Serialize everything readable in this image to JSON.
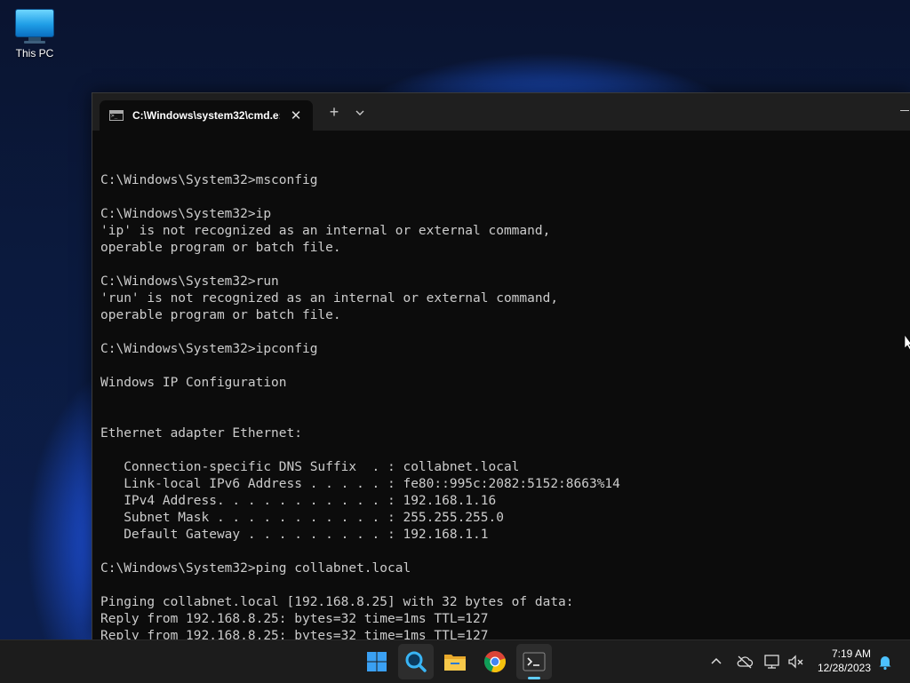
{
  "desktop": {
    "icons": [
      {
        "label": "This PC",
        "icon": "this-pc-icon"
      }
    ]
  },
  "terminal": {
    "tab_title": "C:\\Windows\\system32\\cmd.e:",
    "new_tab_symbol": "+",
    "close_symbol": "✕",
    "console_lines": [
      "",
      "C:\\Windows\\System32>msconfig",
      "",
      "C:\\Windows\\System32>ip",
      "'ip' is not recognized as an internal or external command,",
      "operable program or batch file.",
      "",
      "C:\\Windows\\System32>run",
      "'run' is not recognized as an internal or external command,",
      "operable program or batch file.",
      "",
      "C:\\Windows\\System32>ipconfig",
      "",
      "Windows IP Configuration",
      "",
      "",
      "Ethernet adapter Ethernet:",
      "",
      "   Connection-specific DNS Suffix  . : collabnet.local",
      "   Link-local IPv6 Address . . . . . : fe80::995c:2082:5152:8663%14",
      "   IPv4 Address. . . . . . . . . . . : 192.168.1.16",
      "   Subnet Mask . . . . . . . . . . . : 255.255.255.0",
      "   Default Gateway . . . . . . . . . : 192.168.1.1",
      "",
      "C:\\Windows\\System32>ping collabnet.local",
      "",
      "Pinging collabnet.local [192.168.8.25] with 32 bytes of data:",
      "Reply from 192.168.8.25: bytes=32 time=1ms TTL=127",
      "Reply from 192.168.8.25: bytes=32 time=1ms TTL=127"
    ]
  },
  "taskbar": {
    "apps": [
      {
        "name": "start",
        "icon": "windows-logo-icon",
        "active": false
      },
      {
        "name": "search",
        "icon": "search-icon",
        "active": false
      },
      {
        "name": "file-explorer",
        "icon": "folder-icon",
        "active": false
      },
      {
        "name": "chrome",
        "icon": "chrome-icon",
        "active": false
      },
      {
        "name": "terminal",
        "icon": "terminal-icon",
        "active": true
      }
    ],
    "tray": {
      "icons": [
        "chevron-up-icon",
        "cloud-offline-icon",
        "network-icon",
        "volume-muted-icon",
        "notification-bell-icon"
      ],
      "time": "7:19 AM",
      "date": "12/28/2023"
    }
  },
  "colors": {
    "console_text": "#cccccc",
    "console_bg": "#0c0c0c",
    "titlebar": "#1f1f1f",
    "taskbar": "#1c1c1c",
    "accent": "#60cdff"
  }
}
